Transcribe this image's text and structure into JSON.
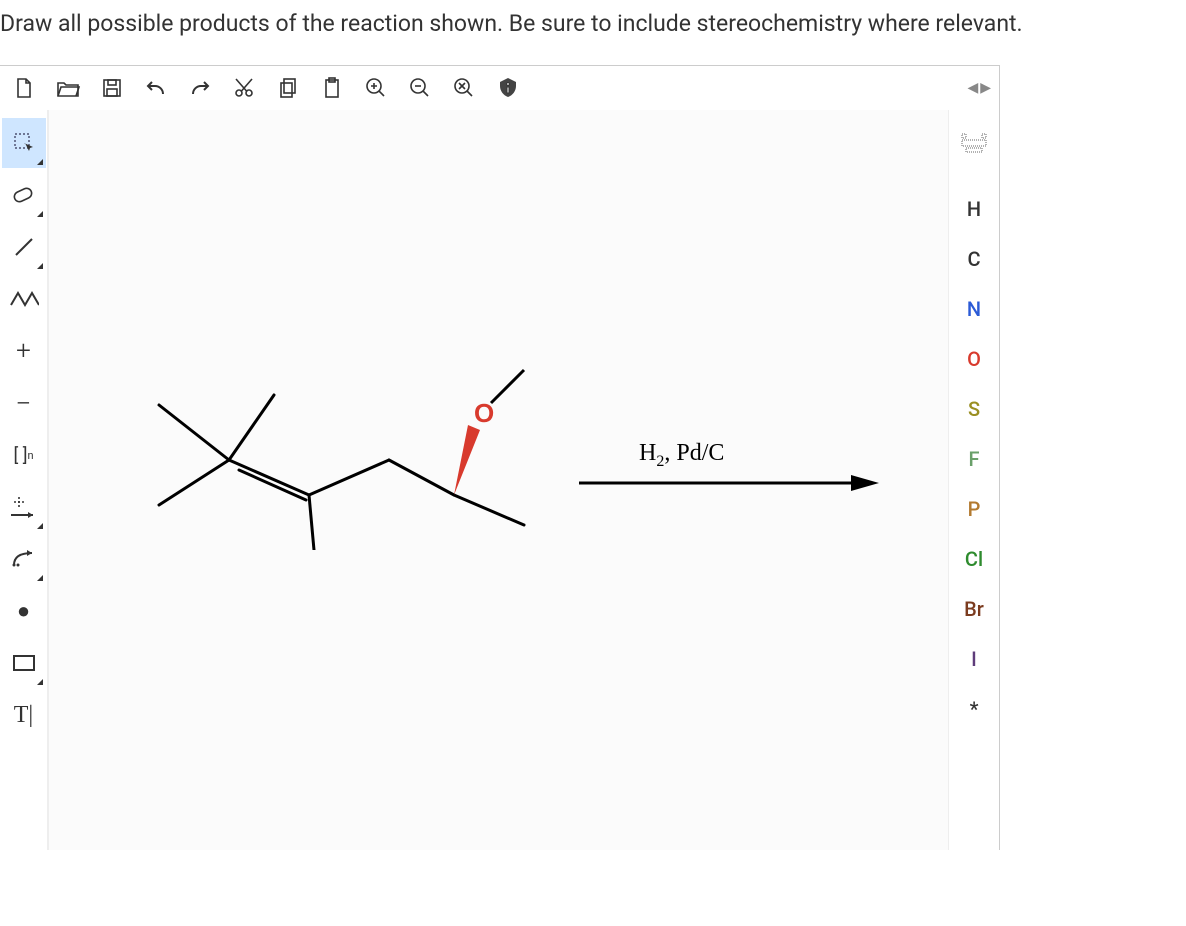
{
  "question": "Draw all possible products of the reaction shown. Be sure to include stereochemistry where relevant.",
  "reaction": {
    "reagent_html": "H<sub>2</sub>, Pd/C"
  },
  "top_toolbar": [
    {
      "name": "new-icon"
    },
    {
      "name": "open-icon"
    },
    {
      "name": "save-icon"
    },
    {
      "name": "undo-icon"
    },
    {
      "name": "redo-icon"
    },
    {
      "name": "cut-icon"
    },
    {
      "name": "copy-icon"
    },
    {
      "name": "paste-icon"
    },
    {
      "name": "zoom-in-icon"
    },
    {
      "name": "zoom-out-icon"
    },
    {
      "name": "zoom-reset-icon"
    },
    {
      "name": "info-icon"
    }
  ],
  "left_toolbar": [
    {
      "name": "selection-tool",
      "selected": true,
      "corner": true
    },
    {
      "name": "eraser-tool",
      "corner": true
    },
    {
      "name": "single-bond-tool",
      "corner": true
    },
    {
      "name": "chain-tool"
    },
    {
      "name": "charge-plus-tool",
      "label": "+"
    },
    {
      "name": "charge-minus-tool",
      "label": "−"
    },
    {
      "name": "bracket-tool",
      "label": "[ ]ₙ"
    },
    {
      "name": "reaction-plus-tool",
      "corner": true
    },
    {
      "name": "arrow-tool",
      "corner": true
    },
    {
      "name": "radical-tool",
      "label": "●"
    },
    {
      "name": "shape-tool",
      "corner": true
    },
    {
      "name": "text-tool",
      "label": "T|"
    }
  ],
  "right_toolbar": [
    {
      "name": "periodic-table-icon",
      "label": "",
      "color": "#333"
    },
    {
      "name": "element-h",
      "label": "H",
      "color": "#333"
    },
    {
      "name": "element-c",
      "label": "C",
      "color": "#333"
    },
    {
      "name": "element-n",
      "label": "N",
      "color": "#2b5bd6"
    },
    {
      "name": "element-o",
      "label": "O",
      "color": "#d83a2d"
    },
    {
      "name": "element-s",
      "label": "S",
      "color": "#9a8f22"
    },
    {
      "name": "element-f",
      "label": "F",
      "color": "#6aa06a"
    },
    {
      "name": "element-p",
      "label": "P",
      "color": "#b37a2f"
    },
    {
      "name": "element-cl",
      "label": "Cl",
      "color": "#2e8b2e"
    },
    {
      "name": "element-br",
      "label": "Br",
      "color": "#7b3b1f"
    },
    {
      "name": "element-i",
      "label": "I",
      "color": "#5e3c7a"
    },
    {
      "name": "element-wildcard",
      "label": "*",
      "color": "#333"
    }
  ]
}
